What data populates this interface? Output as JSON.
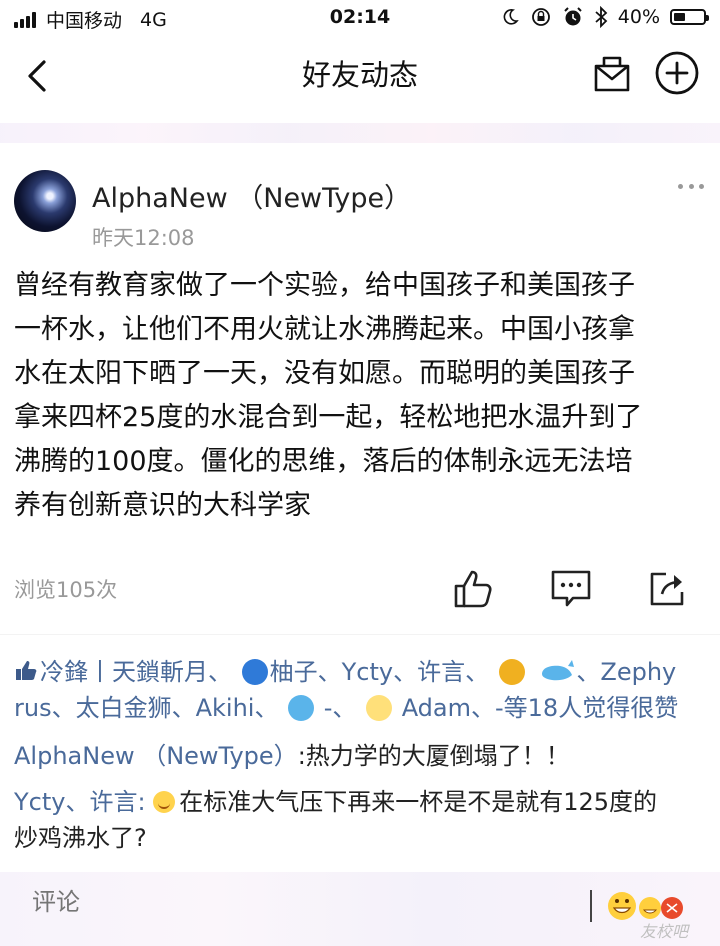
{
  "status_bar": {
    "carrier": "中国移动",
    "network": "4G",
    "time": "02:14",
    "battery": "40%",
    "battery_level": 0.4
  },
  "nav": {
    "title": "好友动态"
  },
  "post": {
    "author": "AlphaNew （NewType）",
    "time": "昨天12:08",
    "content_lines": [
      "曾经有教育家做了一个实验，给中国孩子和美国孩子",
      "一杯水，让他们不用火就让水沸腾起来。中国小孩拿",
      "水在太阳下晒了一天，没有如愿。而聪明的美国孩子",
      "拿来四杯25度的水混合到一起，轻松地把水温升到了",
      "沸腾的100度。僵化的思维，落后的体制永远无法培",
      "养有创新意识的大科学家"
    ],
    "views": "浏览105次"
  },
  "likes": {
    "seg1": "冷鋒丨天鎖斬月、",
    "seg2": "柚子、Ycty、许言、",
    "seg3": "、Zephy",
    "seg4": "rus、太白金狮、Akihi、",
    "seg5": "-、",
    "seg6": "Adam、-等18人觉得很赞"
  },
  "comments": [
    {
      "name": "AlphaNew （NewType）",
      "text": ":热力学的大厦倒塌了！！"
    },
    {
      "name": "Ycty、许言:",
      "text_line1": "在标准大气压下再来一杯是不是就有125度的",
      "text_line2": "炒鸡沸水了?"
    }
  ],
  "bottom": {
    "placeholder": "评论",
    "watermark": "友校吧"
  },
  "colors": {
    "link_blue": "#4a6a9a",
    "muted_gray": "#999999",
    "text": "#111111"
  },
  "icons": [
    "signal-icon",
    "moon-icon",
    "lock-rotation-icon",
    "alarm-icon",
    "bluetooth-icon",
    "battery-icon",
    "back-chevron-icon",
    "mail-icon",
    "add-circle-icon",
    "more-dots-icon",
    "thumbs-up-icon",
    "comment-icon",
    "share-icon",
    "emoji-icon"
  ]
}
